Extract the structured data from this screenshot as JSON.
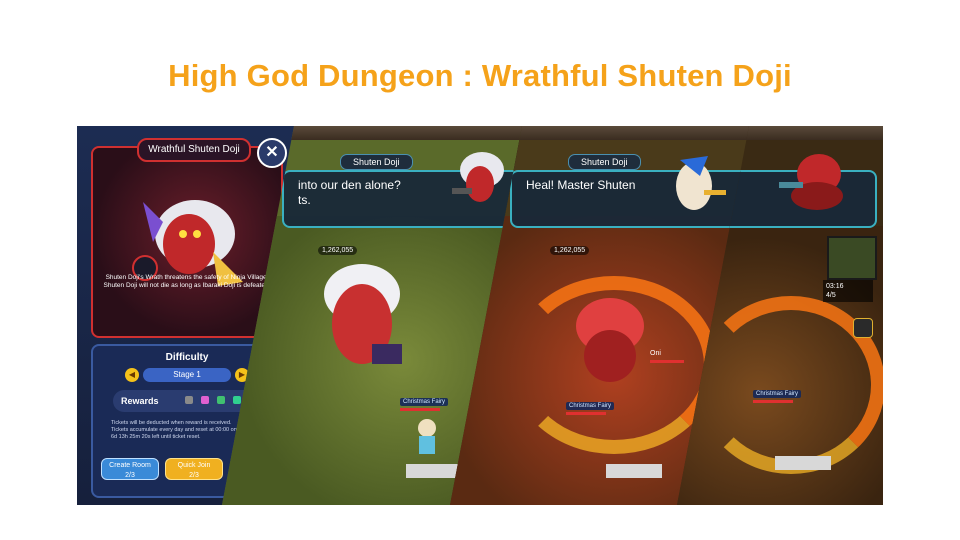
{
  "heading": "High God Dungeon : Wrathful Shuten Doji",
  "info_panel": {
    "boss_title": "Wrathful Shuten Doji",
    "close_icon": "close-icon",
    "description": "Shuten Doji's Wrath threatens the safety of Ninja Village. Shuten Doji will not die as long as Ibaraki Doji is defeated.",
    "difficulty_label": "Difficulty",
    "stage_value": "Stage 1",
    "rewards_label": "Rewards",
    "notes": [
      "Tickets will be deducted when reward is received.",
      "Tickets accumulate every day and reset at 00:00 on Monday.",
      "6d 13h 25m 20s left until ticket reset."
    ],
    "create_room_label": "Create Room",
    "create_room_count": "2/3",
    "quick_join_label": "Quick Join",
    "quick_join_count": "2/3"
  },
  "scene_two": {
    "speaker": "Shuten Doji",
    "line_1": "into our den alone?",
    "line_2": "ts.",
    "power": "1,262,055",
    "nametag": "Christmas Fairy"
  },
  "scene_three": {
    "speaker": "Shuten Doji",
    "line": "Heal! Master Shuten",
    "power": "1,262,055",
    "enemy_label": "Oni",
    "nametag": "Christmas Fairy"
  },
  "scene_four": {
    "timer": "03:16",
    "wave": "4/5",
    "nametag": "Christmas Fairy"
  },
  "colors": {
    "heading": "#f5a21a",
    "dialog_border": "#3ab0c0",
    "frame_red": "#d03030"
  }
}
